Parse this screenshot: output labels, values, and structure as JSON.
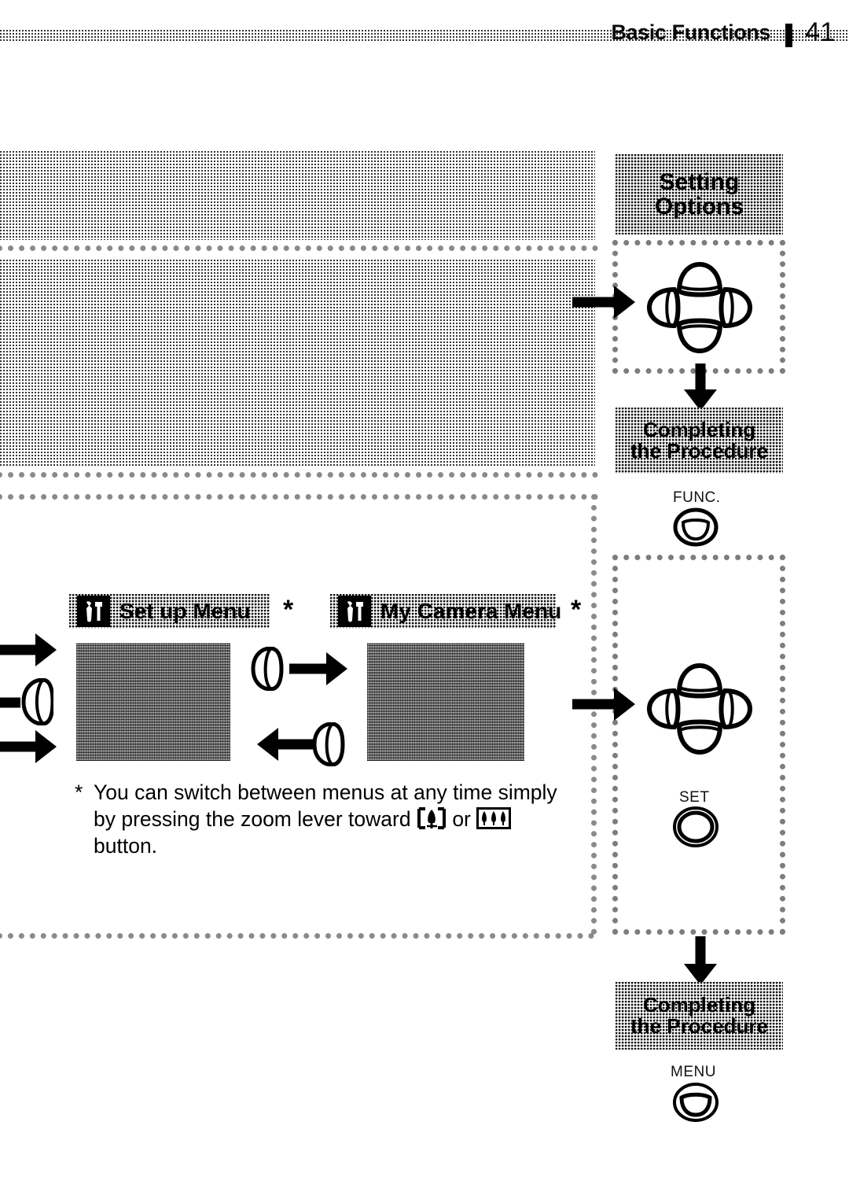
{
  "header": {
    "title": "Basic Functions",
    "page_number": "41",
    "separator_icon": "vertical-bar-divider"
  },
  "flow": {
    "setting_options": {
      "line1": "Setting",
      "line2": "Options"
    },
    "completing_top": {
      "line1": "Completing",
      "line2": "the Procedure"
    },
    "completing_bottom": {
      "line1": "Completing",
      "line2": "the Procedure"
    }
  },
  "buttons": {
    "func": {
      "label": "FUNC.",
      "icon": "func-button-circle"
    },
    "set": {
      "label": "SET",
      "icon": "set-button-circle"
    },
    "menu": {
      "label": "MENU",
      "icon": "menu-button-circle"
    }
  },
  "menus": [
    {
      "label": "Set up Menu",
      "icon": "wrench-screwdriver-icon",
      "footnote_mark": "*",
      "screen": "setup-menu-lcd-screenshot"
    },
    {
      "label": "My Camera Menu",
      "icon": "wrench-screwdriver-icon",
      "footnote_mark": "*",
      "screen": "my-camera-menu-lcd-screenshot"
    }
  ],
  "footnote": {
    "mark": "*",
    "part1": "You can switch between menus at any time simply by pressing the zoom lever toward ",
    "icon_tele": "telephoto-single-tree-icon",
    "part2": " or ",
    "icon_wide": "wide-angle-three-trees-icon",
    "part3": " button."
  },
  "controls": {
    "joystick_top": "omni-selector-four-way-pad",
    "joystick_bottom": "omni-selector-four-way-pad",
    "zoom_lever_left": "zoom-lever-icon",
    "zoom_lever_to_my_camera": "zoom-lever-icon",
    "zoom_lever_to_set_up": "zoom-lever-icon"
  },
  "colors": {
    "ink": "#000000",
    "paper": "#ffffff",
    "halftone_gray": "#8a8a8a",
    "lcd_gray": "#5d5d5d"
  }
}
